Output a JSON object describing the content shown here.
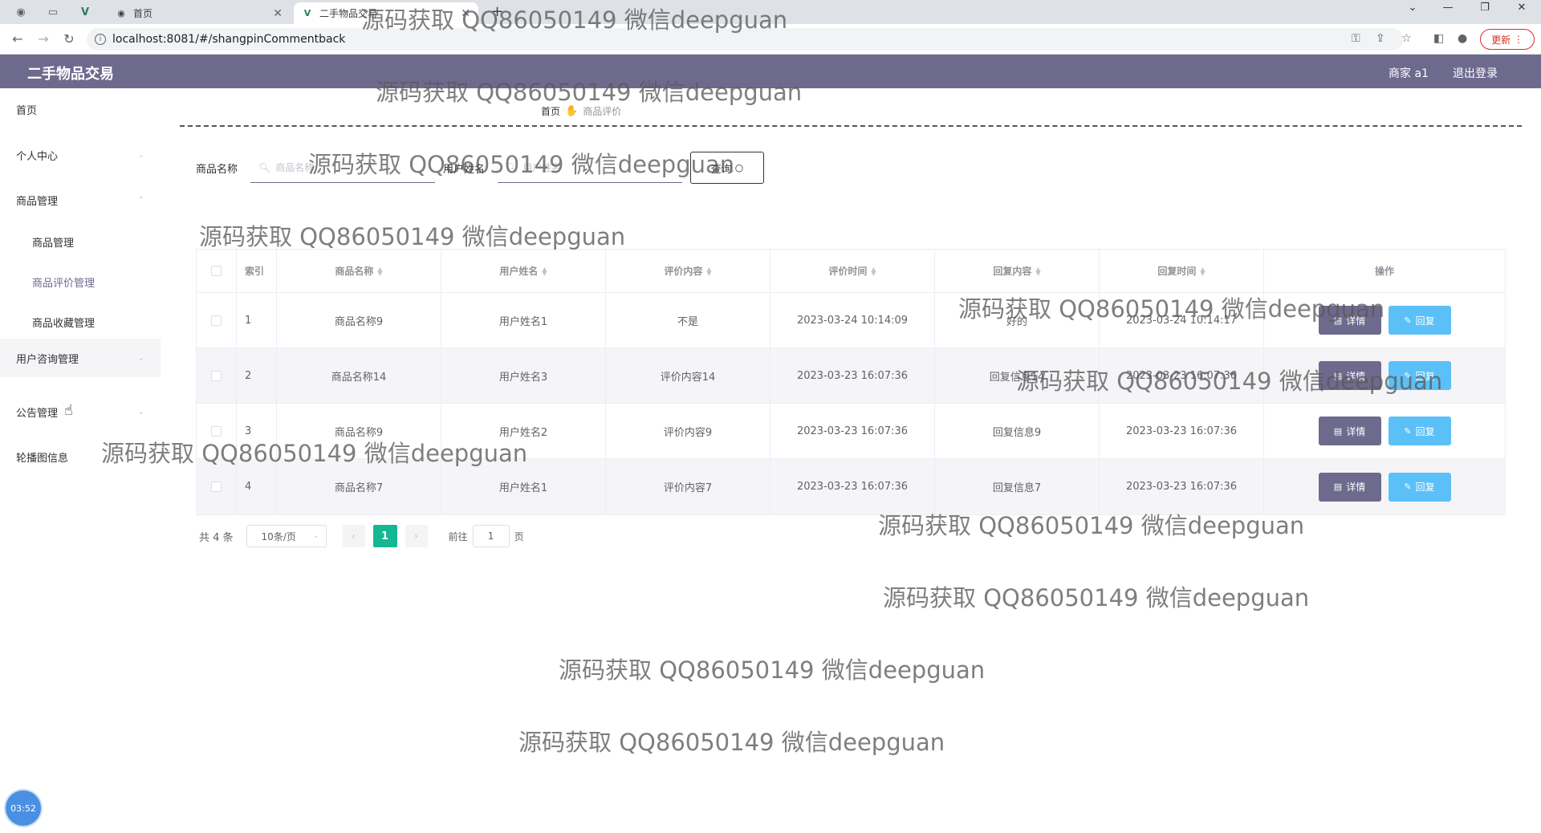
{
  "browser": {
    "tabs": [
      {
        "title": "首页",
        "active": false
      },
      {
        "title": "二手物品交易",
        "active": true
      }
    ],
    "url": "localhost:8081/#/shangpinCommentback",
    "update_label": "更新"
  },
  "header": {
    "app_title": "二手物品交易",
    "user_label": "商家 a1",
    "logout_label": "退出登录"
  },
  "sidebar": {
    "items": [
      {
        "label": "首页"
      },
      {
        "label": "个人中心"
      },
      {
        "label": "商品管理"
      },
      {
        "label": "商品管理"
      },
      {
        "label": "商品评价管理"
      },
      {
        "label": "商品收藏管理"
      },
      {
        "label": "用户咨询管理"
      },
      {
        "label": "公告管理"
      },
      {
        "label": "轮播图信息"
      }
    ]
  },
  "breadcrumb": {
    "home": "首页",
    "current": "商品评价"
  },
  "search": {
    "product_label": "商品名称",
    "product_placeholder": "商品名称",
    "user_label": "用户姓名",
    "user_placeholder": "用户姓名",
    "query_label": "查询"
  },
  "table": {
    "headers": [
      "索引",
      "商品名称",
      "用户姓名",
      "评价内容",
      "评价时间",
      "回复内容",
      "回复时间",
      "操作"
    ],
    "rows": [
      {
        "index": "1",
        "product": "商品名称9",
        "user": "用户姓名1",
        "content": "不是",
        "time": "2023-03-24 10:14:09",
        "reply": "好的",
        "reply_time": "2023-03-24 10:14:17"
      },
      {
        "index": "2",
        "product": "商品名称14",
        "user": "用户姓名3",
        "content": "评价内容14",
        "time": "2023-03-23 16:07:36",
        "reply": "回复信息14",
        "reply_time": "2023-03-23 16:07:36"
      },
      {
        "index": "3",
        "product": "商品名称9",
        "user": "用户姓名2",
        "content": "评价内容9",
        "time": "2023-03-23 16:07:36",
        "reply": "回复信息9",
        "reply_time": "2023-03-23 16:07:36"
      },
      {
        "index": "4",
        "product": "商品名称7",
        "user": "用户姓名1",
        "content": "评价内容7",
        "time": "2023-03-23 16:07:36",
        "reply": "回复信息7",
        "reply_time": "2023-03-23 16:07:36"
      }
    ],
    "detail_label": "详情",
    "reply_label": "回复"
  },
  "pager": {
    "total": "共 4 条",
    "page_size": "10条/页",
    "current_page": "1",
    "goto_label": "前往",
    "goto_value": "1",
    "unit": "页"
  },
  "watermark": "源码获取 QQ86050149 微信deepguan",
  "timer": "03:52",
  "colors": {
    "header": "#6e6a8e",
    "active_page": "#13b892",
    "reply_button": "#5bc0f8"
  }
}
